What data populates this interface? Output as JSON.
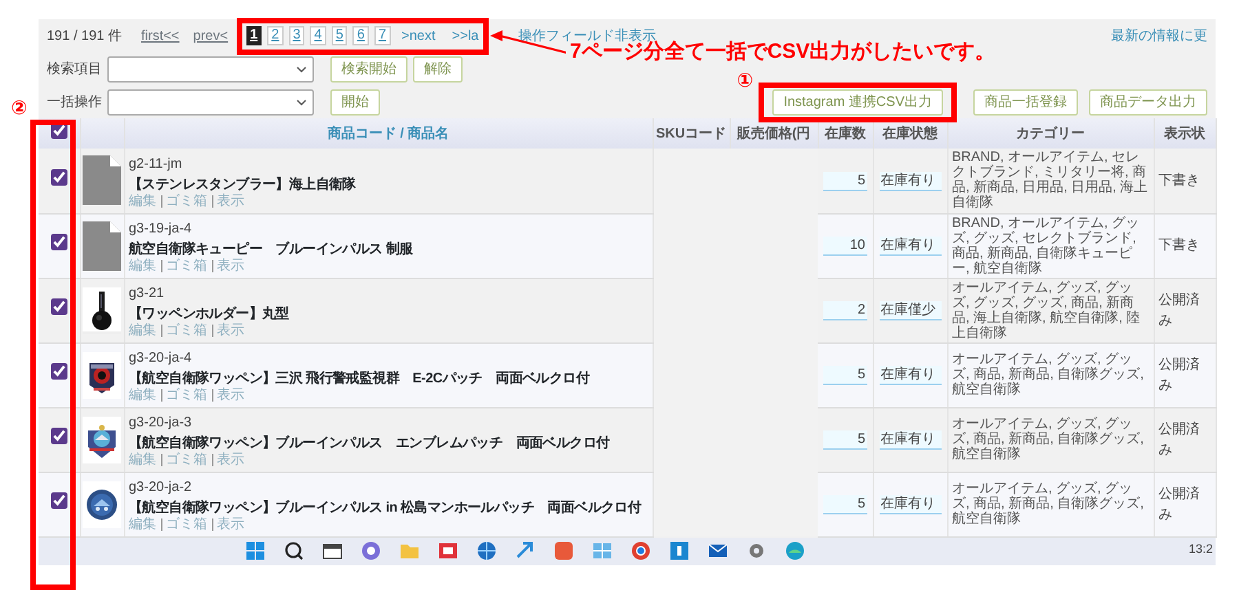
{
  "pager": {
    "count": "191 / 191 件",
    "first": "first<<",
    "prev": "prev<",
    "pages": [
      {
        "label": "1",
        "selected": true
      },
      {
        "label": "2",
        "selected": false
      },
      {
        "label": "3",
        "selected": false
      },
      {
        "label": "4",
        "selected": false
      },
      {
        "label": "5",
        "selected": false
      },
      {
        "label": "6",
        "selected": false
      },
      {
        "label": "7",
        "selected": false
      }
    ],
    "next": ">next",
    "last": ">>la",
    "toggle_fields": "操作フィールド非表示"
  },
  "refresh_link": "最新の情報に更",
  "search": {
    "label": "検索項目",
    "buttons": [
      "検索開始",
      "解除"
    ]
  },
  "bulk": {
    "label": "一括操作",
    "buttons": [
      "開始"
    ]
  },
  "actions": [
    "Instagram 連携CSV出力",
    "商品一括登録",
    "商品データ出力"
  ],
  "table": {
    "select_all_checked": true,
    "columns": [
      "商品コード / 商品名",
      "SKUコード",
      "販売価格(円",
      "在庫数",
      "在庫状態",
      "カテゴリー",
      "表示状"
    ],
    "rows": [
      {
        "checked": true,
        "thumb": {
          "kind": "placeholder"
        },
        "code": "g2-11-jm",
        "name": "【ステンレスタンブラー】海上自衛隊",
        "links": [
          "編集",
          "ゴミ箱",
          "表示"
        ],
        "stock": "5",
        "stock_status": "在庫有り",
        "categories": "BRAND, オールアイテム, セレクトブランド, ミリタリー将, 商品, 新商品, 日用品, 日用品, 海上自衛隊",
        "visibility": "下書き"
      },
      {
        "checked": true,
        "thumb": {
          "kind": "placeholder"
        },
        "code": "g3-19-ja-4",
        "name": "航空自衛隊キューピー　ブルーインパルス 制服",
        "links": [
          "編集",
          "ゴミ箱",
          "表示"
        ],
        "stock": "10",
        "stock_status": "在庫有り",
        "categories": "BRAND, オールアイテム, グッズ, グッズ, セレクトブランド, 商品, 新商品, 自衛隊キューピー, 航空自衛隊",
        "visibility": "下書き"
      },
      {
        "checked": true,
        "code": "g3-21",
        "name": "【ワッペンホルダー】丸型",
        "links": [
          "編集",
          "ゴミ箱",
          "表示"
        ],
        "stock": "2",
        "stock_status": "在庫僅少",
        "categories": "オールアイテム, グッズ, グッズ, グッズ, グッズ, 商品, 新商品, 海上自衛隊, 航空自衛隊, 陸上自衛隊",
        "visibility": "公開済み"
      },
      {
        "checked": true,
        "code": "g3-20-ja-4",
        "name": "【航空自衛隊ワッペン】三沢 飛行警戒監視群　E-2Cパッチ　両面ベルクロ付",
        "links": [
          "編集",
          "ゴミ箱",
          "表示"
        ],
        "stock": "5",
        "stock_status": "在庫有り",
        "categories": "オールアイテム, グッズ, グッズ, 商品, 新商品, 自衛隊グッズ, 航空自衛隊",
        "visibility": "公開済み"
      },
      {
        "checked": true,
        "code": "g3-20-ja-3",
        "name": "【航空自衛隊ワッペン】ブルーインパルス　エンブレムパッチ　両面ベルクロ付",
        "links": [
          "編集",
          "ゴミ箱",
          "表示"
        ],
        "stock": "5",
        "stock_status": "在庫有り",
        "categories": "オールアイテム, グッズ, グッズ, 商品, 新商品, 自衛隊グッズ, 航空自衛隊",
        "visibility": "公開済み"
      },
      {
        "checked": true,
        "code": "g3-20-ja-2",
        "name": "【航空自衛隊ワッペン】ブルーインパルス in 松島マンホールパッチ　両面ベルクロ付",
        "links": [
          "編集",
          "ゴミ箱",
          "表示"
        ],
        "stock": "5",
        "stock_status": "在庫有り",
        "categories": "オールアイテム, グッズ, グッズ, 商品, 新商品, 自衛隊グッズ, 航空自衛隊",
        "visibility": "公開済み"
      }
    ]
  },
  "taskbar": {
    "clock": "13:2"
  },
  "annotations": {
    "callout": "7ページ分全て一括でCSV出力がしたいです。",
    "marker_1": "①",
    "marker_2": "②"
  }
}
